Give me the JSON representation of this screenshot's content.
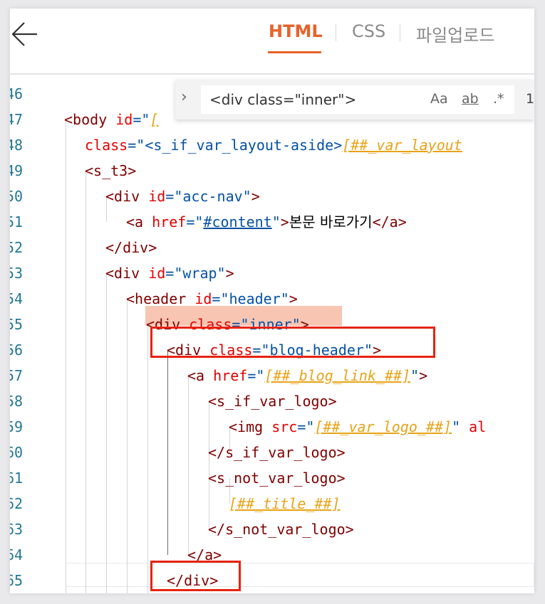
{
  "tabs": [
    {
      "label": "HTML",
      "active": true
    },
    {
      "label": "CSS",
      "active": false
    },
    {
      "label": "파일업로드",
      "active": false
    }
  ],
  "find": {
    "query": "<div class=\"inner\">",
    "match_case_label": "Aa",
    "whole_word_label": "ab",
    "regex_label": ".*",
    "count_label": "1"
  },
  "gutter": [
    "46",
    "47",
    "48",
    "49",
    "50",
    "51",
    "52",
    "53",
    "54",
    "55",
    "56",
    "57",
    "58",
    "59",
    "60",
    "61",
    "62",
    "63",
    "64",
    "65"
  ],
  "accent_color": "#e8622a",
  "highlight_color": "#e8230f",
  "code": {
    "l47": {
      "a": "<body",
      "b": " id",
      "c": "=\"",
      "d": "["
    },
    "l48": {
      "a": "class",
      "b": "=\"",
      "c": "<s_if_var_layout-aside>",
      "d": "[##_var_layout"
    },
    "l49": {
      "a": "<s_t3>"
    },
    "l50": {
      "a": "<div",
      "b": " id",
      "c": "=\"acc-nav\"",
      "d": ">"
    },
    "l51": {
      "a": "<a",
      "b": " href",
      "c": "=\"",
      "d": "#content",
      "e": "\"",
      "f": ">",
      "g": "본문 바로가기",
      "h": "</a>"
    },
    "l52": {
      "a": "</div>"
    },
    "l53": {
      "a": "<div",
      "b": " id",
      "c": "=\"wrap\"",
      "d": ">"
    },
    "l54": {
      "a": "<header",
      "b": " id",
      "c": "=\"header\"",
      "d": ">"
    },
    "l55": {
      "a": "<div",
      "b": " class",
      "c": "=\"inner\"",
      "d": ">"
    },
    "l56": {
      "a": "<div",
      "b": " class",
      "c": "=\"blog-header\"",
      "d": ">"
    },
    "l57": {
      "a": "<a",
      "b": " href",
      "c": "=\"",
      "d": "[##_blog_link_##]",
      "e": "\"",
      "f": ">"
    },
    "l58": {
      "a": "<s_if_var_logo>"
    },
    "l59": {
      "a": "<img",
      "b": " src",
      "c": "=\"",
      "d": "[##_var_logo_##]",
      "e": "\"",
      "f": " al"
    },
    "l60": {
      "a": "</s_if_var_logo>"
    },
    "l61": {
      "a": "<s_not_var_logo>"
    },
    "l62": {
      "a": "[##_title_##]"
    },
    "l63": {
      "a": "</s_not_var_logo>"
    },
    "l64": {
      "a": "</a>"
    },
    "l65": {
      "a": "</div>"
    }
  }
}
